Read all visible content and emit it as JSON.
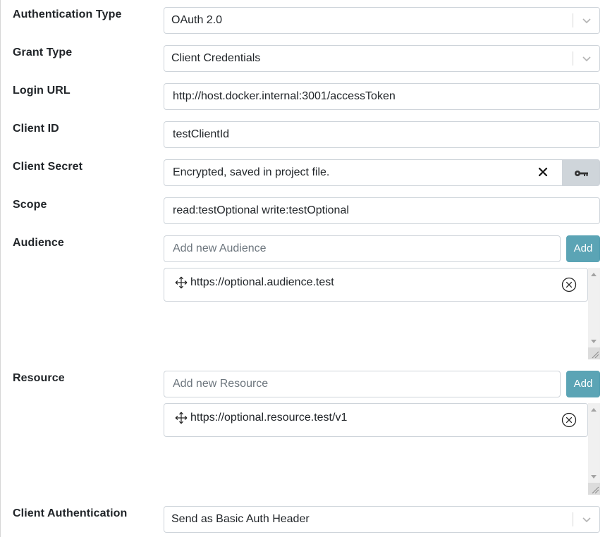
{
  "form": {
    "auth_type": {
      "label": "Authentication Type",
      "value": "OAuth 2.0"
    },
    "grant_type": {
      "label": "Grant Type",
      "value": "Client Credentials"
    },
    "login_url": {
      "label": "Login URL",
      "value": "http://host.docker.internal:3001/accessToken"
    },
    "client_id": {
      "label": "Client ID",
      "value": "testClientId"
    },
    "client_secret": {
      "label": "Client Secret",
      "value": "Encrypted, saved in project file."
    },
    "scope": {
      "label": "Scope",
      "value": "read:testOptional write:testOptional"
    },
    "audience": {
      "label": "Audience",
      "placeholder": "Add new Audience",
      "add_label": "Add",
      "items": [
        "https://optional.audience.test"
      ]
    },
    "resource": {
      "label": "Resource",
      "placeholder": "Add new Resource",
      "add_label": "Add",
      "items": [
        "https://optional.resource.test/v1"
      ]
    },
    "client_auth": {
      "label": "Client Authentication",
      "value": "Send as Basic Auth Header"
    }
  },
  "icons": {
    "chevron": "chevron-down-icon",
    "clear": "close-icon",
    "key": "key-icon",
    "move": "move-icon",
    "remove": "remove-circle-icon"
  },
  "colors": {
    "add_button": "#5ba4b5",
    "key_button": "#cfd5da",
    "border": "#ced4da"
  }
}
